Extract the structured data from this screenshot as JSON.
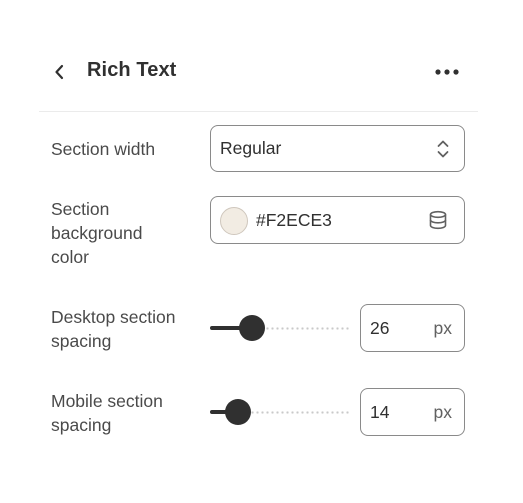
{
  "header": {
    "title": "Rich Text",
    "back_icon": "chevron-left-icon",
    "more_icon": "horizontal-dots-icon"
  },
  "fields": {
    "section_width": {
      "label": "Section width",
      "value": "Regular",
      "icon": "chevron-up-down-icon"
    },
    "background_color": {
      "label_lines": [
        "Section",
        "background",
        "color"
      ],
      "value": "#F2ECE3",
      "swatch_color": "#F2ECE3",
      "icon": "database-icon"
    },
    "desktop_spacing": {
      "label_lines": [
        "Desktop section",
        "spacing"
      ],
      "value": "26",
      "unit": "px",
      "slider_fraction": 0.3
    },
    "mobile_spacing": {
      "label_lines": [
        "Mobile section",
        "spacing"
      ],
      "value": "14",
      "unit": "px",
      "slider_fraction": 0.2
    }
  },
  "colors": {
    "text": "#303030",
    "border": "#8a8a8a",
    "slider_active": "#303030"
  }
}
